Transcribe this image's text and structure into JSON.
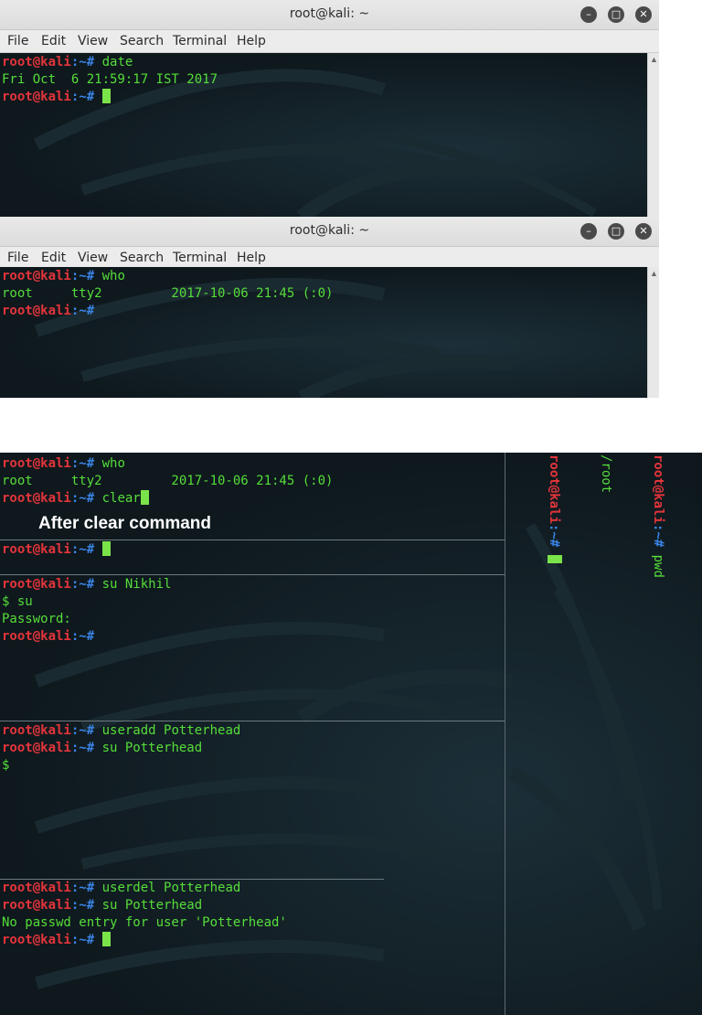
{
  "window1": {
    "title": "root@kali: ~",
    "menu": [
      "File",
      "Edit",
      "View",
      "Search",
      "Terminal",
      "Help"
    ],
    "buttons": {
      "minimize": "minimize-icon",
      "maximize": "maximize-icon",
      "close": "close-icon"
    },
    "lines": [
      {
        "user": "root@kali",
        "path": ":~#",
        "cmd": " date"
      },
      {
        "out": "Fri Oct  6 21:59:17 IST 2017"
      },
      {
        "user": "root@kali",
        "path": ":~#",
        "cmd": " "
      }
    ]
  },
  "window2": {
    "title": "root@kali: ~",
    "menu": [
      "File",
      "Edit",
      "View",
      "Search",
      "Terminal",
      "Help"
    ],
    "lines": [
      {
        "user": "root@kali",
        "path": ":~#",
        "cmd": " who"
      },
      {
        "out": "root     tty2         2017-10-06 21:45 (:0)"
      },
      {
        "user": "root@kali",
        "path": ":~#",
        "cmd": ""
      }
    ]
  },
  "clear_panel": {
    "lines": [
      {
        "user": "root@kali",
        "path": ":~#",
        "cmd": " who"
      },
      {
        "out": "root     tty2         2017-10-06 21:45 (:0)"
      },
      {
        "user": "root@kali",
        "path": ":~#",
        "cmd": " clear"
      }
    ],
    "caption": "After clear command",
    "after": {
      "user": "root@kali",
      "path": ":~#",
      "cmd": " "
    }
  },
  "su_panel": {
    "lines": [
      {
        "user": "root@kali",
        "path": ":~#",
        "cmd": " su Nikhil"
      },
      {
        "out": "$ su"
      },
      {
        "out": "Password:"
      },
      {
        "user": "root@kali",
        "path": ":~#",
        "cmd": ""
      }
    ]
  },
  "useradd_panel": {
    "lines": [
      {
        "user": "root@kali",
        "path": ":~#",
        "cmd": " useradd Potterhead"
      },
      {
        "user": "root@kali",
        "path": ":~#",
        "cmd": " su Potterhead"
      },
      {
        "out": "$"
      }
    ]
  },
  "userdel_panel": {
    "lines": [
      {
        "user": "root@kali",
        "path": ":~#",
        "cmd": " userdel Potterhead"
      },
      {
        "user": "root@kali",
        "path": ":~#",
        "cmd": " su Potterhead"
      },
      {
        "out": "No passwd entry for user 'Potterhead'"
      },
      {
        "user": "root@kali",
        "path": ":~#",
        "cmd": " "
      }
    ]
  },
  "pwd_panel": {
    "lines": [
      {
        "user": "root@kali",
        "path": ":~#",
        "cmd": " pwd"
      },
      {
        "out": "/root"
      },
      {
        "user": "root@kali",
        "path": ":~#",
        "cmd": " "
      }
    ]
  },
  "colors": {
    "prompt_user": "#e2353b",
    "prompt_path": "#3a84e6",
    "text": "#56dd3a",
    "cursor": "#7be34a",
    "terminal_bg": "#0f1a1f"
  }
}
